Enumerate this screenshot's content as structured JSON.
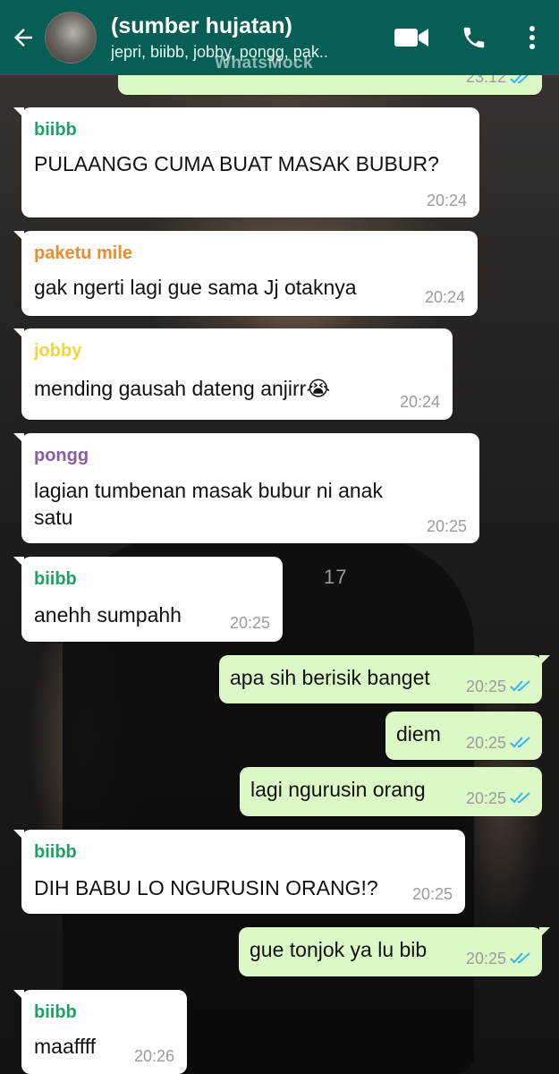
{
  "header": {
    "title": "(sumber hujatan)",
    "members": "jepri, biibb, jobby, pongg, pak..",
    "watermark": "WhatsMock"
  },
  "icons": {
    "back": "back-arrow-icon",
    "video": "video-call-icon",
    "call": "phone-icon",
    "menu": "more-options-icon",
    "read": "double-check-icon"
  },
  "colors": {
    "header": "#075e54",
    "incoming": "#ffffff",
    "outgoing": "#dcf8c6",
    "read_ticks": "#34b7f1",
    "biibb": "#1fa163",
    "paketu_mile": "#f08b2a",
    "jobby": "#f2d53c",
    "pongg": "#8b5ca6"
  },
  "messages": {
    "m0": {
      "time": "23:12"
    },
    "m1": {
      "sender": "biibb",
      "text": "PULAANGG CUMA BUAT MASAK BUBUR?",
      "time": "20:24"
    },
    "m2": {
      "sender": "paketu mile",
      "text": "gak ngerti lagi gue sama Jj otaknya",
      "time": "20:24"
    },
    "m3": {
      "sender": "jobby",
      "text": "mending gausah dateng anjirr😭",
      "time": "20:24"
    },
    "m4": {
      "sender": "pongg",
      "text_line1": "lagian tumbenan masak bubur ni anak",
      "text_line2": "satu",
      "time": "20:25"
    },
    "m5": {
      "sender": "biibb",
      "text": "anehh sumpahh",
      "time": "20:25"
    },
    "m6": {
      "text": "apa sih berisik banget",
      "time": "20:25"
    },
    "m7": {
      "text": "diem",
      "time": "20:25"
    },
    "m8": {
      "text": "lagi ngurusin orang",
      "time": "20:25"
    },
    "m9": {
      "sender": "biibb",
      "text": "DIH BABU LO NGURUSIN ORANG!?",
      "time": "20:25"
    },
    "m10": {
      "text": "gue tonjok ya lu bib",
      "time": "20:25"
    },
    "m11": {
      "sender": "biibb",
      "text": "maaffff",
      "time": "20:26"
    }
  }
}
